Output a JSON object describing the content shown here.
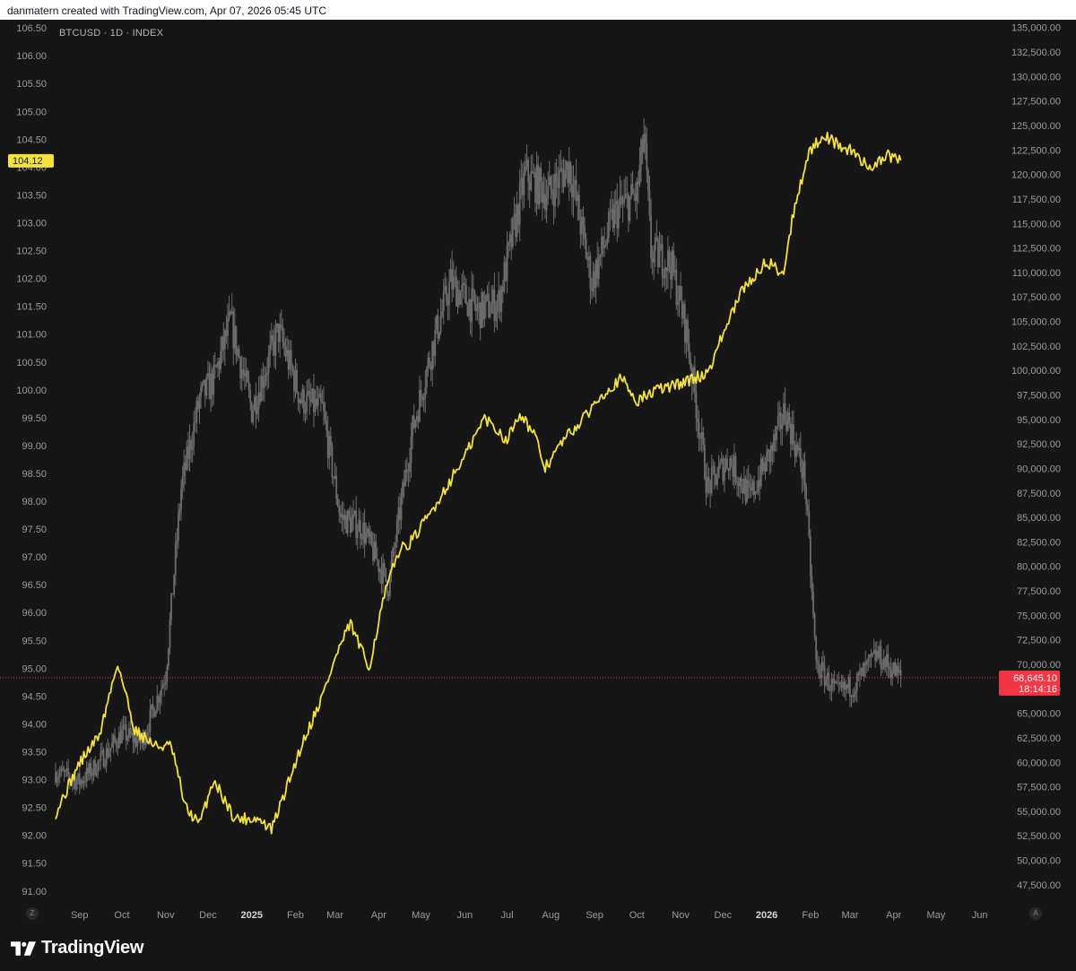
{
  "caption": "danmatern created with TradingView.com, Apr 07, 2026 05:45 UTC",
  "symbol": "BTCUSD · 1D · INDEX",
  "brand": "TradingView",
  "nav": {
    "left": "Z",
    "right": "A"
  },
  "colors": {
    "background": "#161616",
    "candles": "#6b6b6b",
    "line": "#f5e13c",
    "price_marker": "#f23645",
    "last_line_label": "#f5e13c"
  },
  "chart_data": {
    "type": "line",
    "x_ticks": [
      "Sep",
      "Oct",
      "Nov",
      "Dec",
      "2025",
      "Feb",
      "Mar",
      "Apr",
      "May",
      "Jun",
      "Jul",
      "Aug",
      "Sep",
      "Oct",
      "Nov",
      "Dec",
      "2026",
      "Feb",
      "Mar",
      "Apr",
      "May",
      "Jun"
    ],
    "left_axis": {
      "range": [
        90.9,
        106.55
      ],
      "ticks": [
        "106.50",
        "106.00",
        "105.50",
        "105.00",
        "104.50",
        "104.00",
        "103.50",
        "103.00",
        "102.50",
        "102.00",
        "101.50",
        "101.00",
        "100.50",
        "100.00",
        "99.50",
        "99.00",
        "98.50",
        "98.00",
        "97.50",
        "97.00",
        "96.50",
        "96.00",
        "95.50",
        "95.00",
        "94.50",
        "94.00",
        "93.50",
        "93.00",
        "92.50",
        "92.00",
        "91.50",
        "91.00"
      ]
    },
    "right_axis": {
      "range": [
        46300,
        135250
      ],
      "ticks": [
        "135,000.00",
        "132,500.00",
        "130,000.00",
        "127,500.00",
        "125,000.00",
        "122,500.00",
        "120,000.00",
        "117,500.00",
        "115,000.00",
        "112,500.00",
        "110,000.00",
        "107,500.00",
        "105,000.00",
        "102,500.00",
        "100,000.00",
        "97,500.00",
        "95,000.00",
        "92,500.00",
        "90,000.00",
        "87,500.00",
        "85,000.00",
        "82,500.00",
        "80,000.00",
        "77,500.00",
        "75,000.00",
        "72,500.00",
        "70,000.00",
        "67,500.00",
        "65,000.00",
        "62,500.00",
        "60,000.00",
        "57,500.00",
        "55,000.00",
        "52,500.00",
        "50,000.00",
        "47,500.00"
      ]
    },
    "series": [
      {
        "name": "BTCUSD",
        "axis": "right",
        "style": "candles",
        "x": [
          "2024-08-15",
          "2024-09-01",
          "2024-09-15",
          "2024-10-01",
          "2024-10-15",
          "2024-11-01",
          "2024-11-12",
          "2024-11-25",
          "2024-12-05",
          "2024-12-17",
          "2025-01-01",
          "2025-01-20",
          "2025-02-05",
          "2025-02-20",
          "2025-03-05",
          "2025-03-20",
          "2025-04-08",
          "2025-04-25",
          "2025-05-10",
          "2025-05-22",
          "2025-06-10",
          "2025-06-25",
          "2025-07-14",
          "2025-07-30",
          "2025-08-14",
          "2025-08-30",
          "2025-09-15",
          "2025-10-01",
          "2025-10-06",
          "2025-10-11",
          "2025-10-25",
          "2025-11-05",
          "2025-11-20",
          "2025-12-05",
          "2025-12-20",
          "2026-01-05",
          "2026-01-14",
          "2026-01-28",
          "2026-02-05",
          "2026-02-20",
          "2026-03-05",
          "2026-03-20",
          "2026-04-06"
        ],
        "values": [
          59000,
          58000,
          60000,
          63000,
          62000,
          69000,
          88000,
          97000,
          99000,
          105000,
          96000,
          104000,
          97000,
          96000,
          85000,
          84000,
          78000,
          94000,
          103000,
          109000,
          106000,
          107000,
          120000,
          118000,
          121000,
          109000,
          116000,
          118000,
          124000,
          112000,
          111000,
          104000,
          88000,
          91000,
          87000,
          92000,
          96000,
          89000,
          70000,
          67000,
          68000,
          71000,
          68645.1
        ]
      },
      {
        "name": "",
        "axis": "left",
        "style": "line",
        "x": [
          "2024-08-15",
          "2024-09-01",
          "2024-09-15",
          "2024-09-28",
          "2024-10-10",
          "2024-10-25",
          "2024-11-05",
          "2024-11-15",
          "2024-11-25",
          "2024-12-05",
          "2024-12-20",
          "2025-01-05",
          "2025-01-15",
          "2025-01-25",
          "2025-02-05",
          "2025-02-20",
          "2025-03-03",
          "2025-03-12",
          "2025-03-25",
          "2025-04-05",
          "2025-04-15",
          "2025-04-25",
          "2025-05-08",
          "2025-05-20",
          "2025-06-01",
          "2025-06-15",
          "2025-07-01",
          "2025-07-10",
          "2025-07-20",
          "2025-07-28",
          "2025-08-10",
          "2025-08-25",
          "2025-09-05",
          "2025-09-20",
          "2025-10-01",
          "2025-10-15",
          "2025-10-30",
          "2025-11-10",
          "2025-11-20",
          "2025-12-01",
          "2025-12-15",
          "2026-01-01",
          "2026-01-13",
          "2026-01-20",
          "2026-01-30",
          "2026-02-10",
          "2026-02-20",
          "2026-03-01",
          "2026-03-15",
          "2026-03-28",
          "2026-04-06"
        ],
        "values": [
          92.4,
          93.3,
          93.8,
          95.1,
          93.9,
          93.6,
          93.6,
          92.5,
          92.2,
          93.0,
          92.3,
          92.3,
          92.1,
          92.8,
          93.6,
          94.5,
          95.3,
          95.8,
          95.0,
          96.3,
          97.1,
          97.3,
          97.8,
          98.3,
          98.8,
          99.5,
          99.1,
          99.6,
          99.2,
          98.6,
          99.1,
          99.5,
          99.9,
          100.2,
          99.8,
          100.0,
          100.1,
          100.2,
          100.3,
          101.0,
          101.8,
          102.3,
          102.1,
          103.2,
          104.2,
          104.6,
          104.4,
          104.3,
          104.0,
          104.2,
          104.12
        ]
      }
    ],
    "last_labels": {
      "left": "104.12",
      "right_price": "68,645.10",
      "right_timer": "18:14:16"
    },
    "price_line": 68645.1
  }
}
